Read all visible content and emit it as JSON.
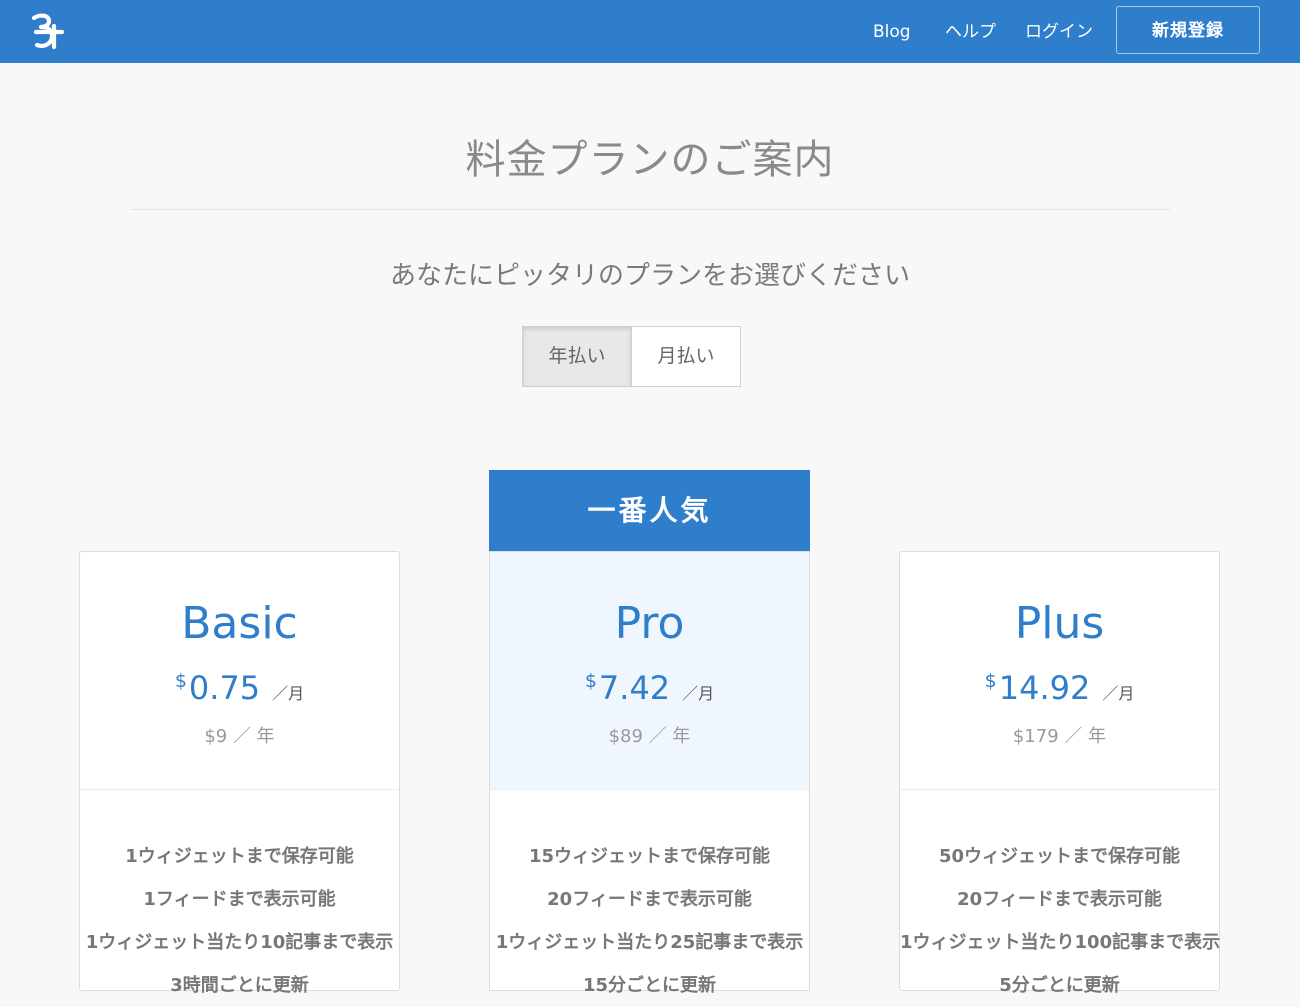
{
  "nav": {
    "links": [
      "Blog",
      "ヘルプ",
      "ログイン"
    ],
    "signup": "新規登録"
  },
  "page": {
    "title": "料金プランのご案内",
    "subtitle": "あなたにピッタリのプランをお選びください"
  },
  "billing_toggle": {
    "options": [
      "年払い",
      "月払い"
    ],
    "selected": "年払い"
  },
  "popular_label": "一番人気",
  "colors": {
    "brand": "#2f7ecb",
    "pro_highlight": "#f0f6fd"
  },
  "icons": {
    "logo": "logo-icon"
  },
  "plans": [
    {
      "name": "Basic",
      "currency": "$",
      "monthly": "0.75",
      "per_month": "／月",
      "yearly": "$9 ／ 年",
      "features": [
        "1ウィジェットまで保存可能",
        "1フィードまで表示可能",
        "1ウィジェット当たり10記事まで表示",
        "3時間ごとに更新"
      ]
    },
    {
      "name": "Pro",
      "currency": "$",
      "monthly": "7.42",
      "per_month": "／月",
      "yearly": "$89 ／ 年",
      "features": [
        "15ウィジェットまで保存可能",
        "20フィードまで表示可能",
        "1ウィジェット当たり25記事まで表示",
        "15分ごとに更新"
      ]
    },
    {
      "name": "Plus",
      "currency": "$",
      "monthly": "14.92",
      "per_month": "／月",
      "yearly": "$179 ／ 年",
      "features": [
        "50ウィジェットまで保存可能",
        "20フィードまで表示可能",
        "1ウィジェット当たり100記事まで表示",
        "5分ごとに更新"
      ]
    }
  ]
}
